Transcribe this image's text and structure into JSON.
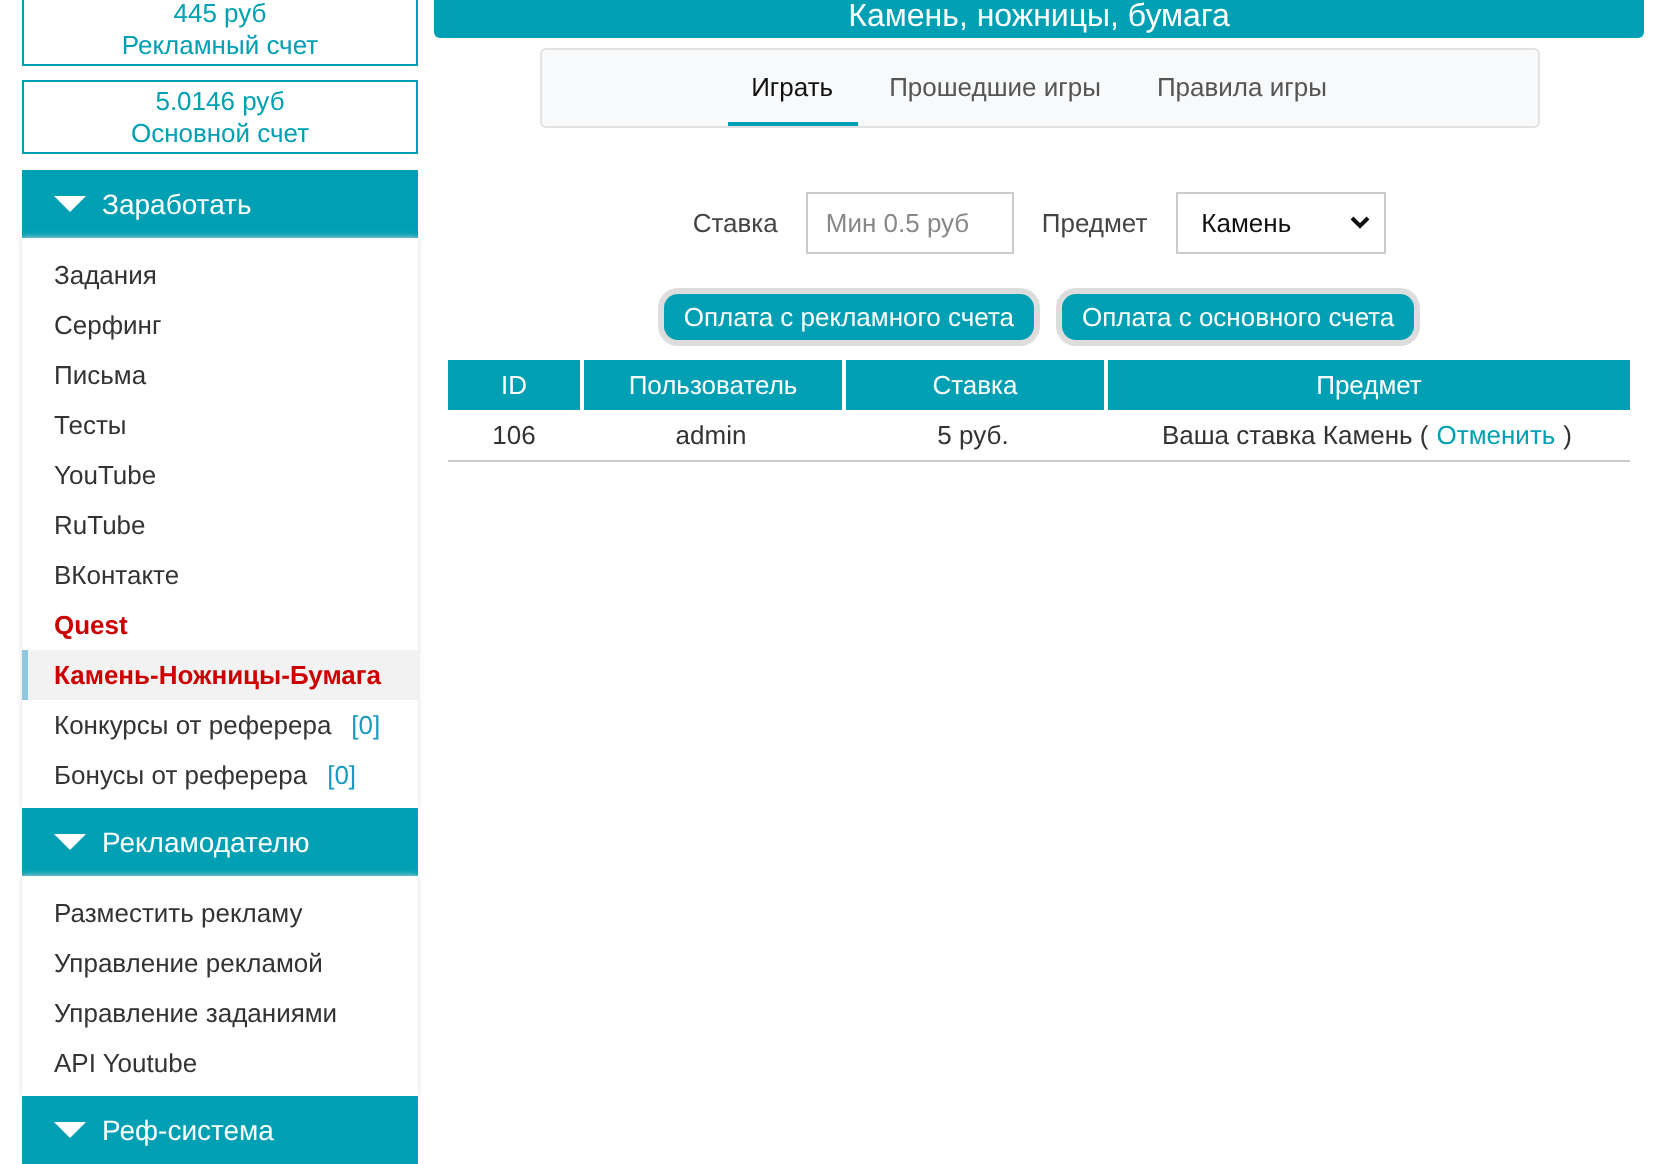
{
  "balances": [
    {
      "amount": "445 руб",
      "label": "Рекламный счет"
    },
    {
      "amount": "5.0146 руб",
      "label": "Основной счет"
    }
  ],
  "menu": [
    {
      "title": "Заработать",
      "expanded": true,
      "items": [
        {
          "label": "Задания",
          "selected": false,
          "accent": false
        },
        {
          "label": "Серфинг",
          "selected": false,
          "accent": false
        },
        {
          "label": "Письма",
          "selected": false,
          "accent": false
        },
        {
          "label": "Тесты",
          "selected": false,
          "accent": false
        },
        {
          "label": "YouTube",
          "selected": false,
          "accent": false
        },
        {
          "label": "RuTube",
          "selected": false,
          "accent": false
        },
        {
          "label": "ВКонтакте",
          "selected": false,
          "accent": false
        },
        {
          "label": "Quest",
          "selected": false,
          "accent": true
        },
        {
          "label": "Камень-Ножницы-Бумага",
          "selected": true,
          "accent": true
        },
        {
          "label": "Конкурсы от реферера",
          "count": "[0]",
          "selected": false,
          "accent": false
        },
        {
          "label": "Бонусы от реферера",
          "count": "[0]",
          "selected": false,
          "accent": false
        }
      ]
    },
    {
      "title": "Рекламодателю",
      "expanded": true,
      "items": [
        {
          "label": "Разместить рекламу",
          "selected": false,
          "accent": false
        },
        {
          "label": "Управление рекламой",
          "selected": false,
          "accent": false
        },
        {
          "label": "Управление заданиями",
          "selected": false,
          "accent": false
        },
        {
          "label": "API Youtube",
          "selected": false,
          "accent": false
        }
      ]
    },
    {
      "title": "Реф-система",
      "expanded": true
    }
  ],
  "page_title": "Камень, ножницы, бумага",
  "tabs": [
    {
      "label": "Играть",
      "selected": true
    },
    {
      "label": "Прошедшие игры",
      "selected": false
    },
    {
      "label": "Правила игры",
      "selected": false
    }
  ],
  "form": {
    "bet_label": "Ставка",
    "bet_placeholder": "Мин 0.5 руб",
    "item_label": "Предмет",
    "item_value": "Камень"
  },
  "buttons": [
    "Оплата с рекламного счета",
    "Оплата с основного счета"
  ],
  "table": {
    "columns": [
      "ID",
      "Пользователь",
      "Ставка",
      "Предмет"
    ],
    "rows": [
      {
        "id": "106",
        "user": "admin",
        "bet": "5 руб.",
        "item": "Ваша ставка Камень (",
        "link": "Отменить",
        "tail": ")"
      }
    ]
  }
}
